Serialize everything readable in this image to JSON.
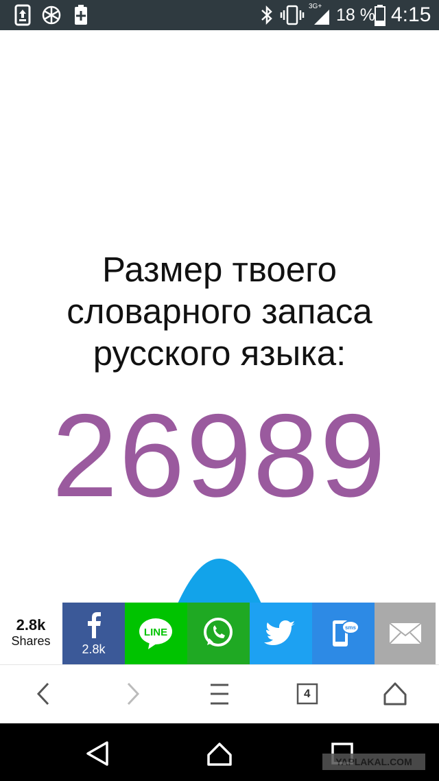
{
  "status_bar": {
    "battery_percent": "18 %",
    "time": "4:15",
    "network": "3G+",
    "icons": [
      "notification-upload-icon",
      "snowflake-icon",
      "battery-saver-icon",
      "bluetooth-icon",
      "vibrate-icon",
      "signal-icon",
      "battery-icon"
    ]
  },
  "result": {
    "headline": "Размер твоего словарного запаса русского языка:",
    "score": "26989",
    "score_color": "#9a5a9e",
    "curve_color": "#12a3ea"
  },
  "share_bar": {
    "count": "2.8k",
    "count_label": "Shares",
    "buttons": [
      {
        "name": "facebook",
        "color": "#3b5998",
        "count": "2.8k"
      },
      {
        "name": "line",
        "color": "#00c300",
        "label": "LINE"
      },
      {
        "name": "whatsapp",
        "color": "#1fa923"
      },
      {
        "name": "twitter",
        "color": "#1da1f2"
      },
      {
        "name": "sms",
        "color": "#2d8ae5",
        "label": "sms"
      },
      {
        "name": "email",
        "color": "#aaaaaa"
      }
    ]
  },
  "browser_toolbar": {
    "tab_count": "4",
    "icons": [
      "back-arrow-icon",
      "forward-arrow-icon",
      "menu-icon",
      "tabs-icon",
      "home-icon"
    ]
  },
  "nav_bar": {
    "icons": [
      "back-icon",
      "home-icon",
      "recents-icon"
    ],
    "watermark": "YAPLAKAL.COM"
  }
}
